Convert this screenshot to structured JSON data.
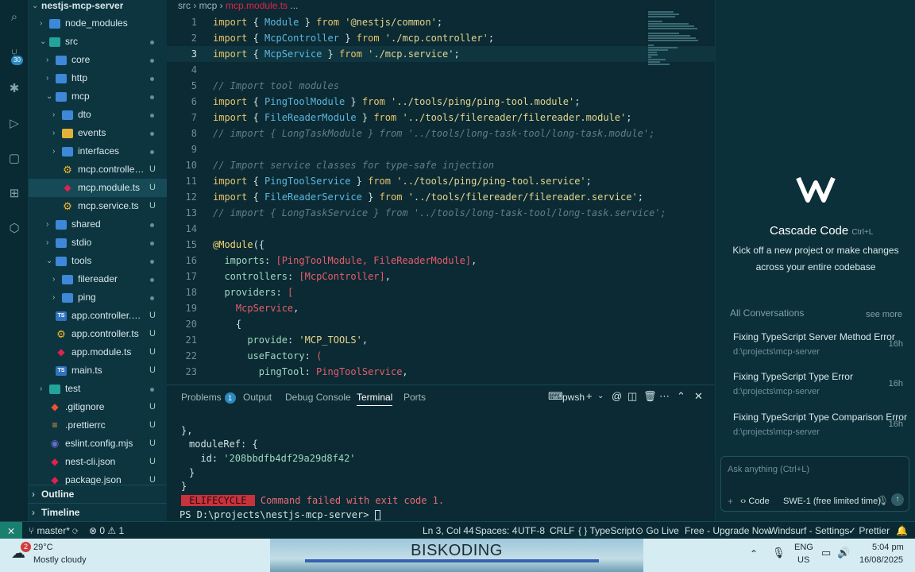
{
  "breadcrumb": [
    "src",
    "mcp",
    "mcp.module.ts",
    "..."
  ],
  "activity": {
    "scm_badge": "30"
  },
  "explorer": {
    "root": "nestjs-mcp-server",
    "rows": [
      {
        "label": "node_modules",
        "depth": 1,
        "kind": "folder",
        "chev": "›",
        "stat": ""
      },
      {
        "label": "src",
        "depth": 1,
        "kind": "folder teal",
        "chev": "⌄",
        "stat": "dot"
      },
      {
        "label": "core",
        "depth": 2,
        "kind": "folder",
        "chev": "›",
        "stat": "dot"
      },
      {
        "label": "http",
        "depth": 2,
        "kind": "folder",
        "chev": "›",
        "stat": "dot"
      },
      {
        "label": "mcp",
        "depth": 2,
        "kind": "folder",
        "chev": "⌄",
        "stat": "dot"
      },
      {
        "label": "dto",
        "depth": 3,
        "kind": "folder",
        "chev": "›",
        "stat": "dot"
      },
      {
        "label": "events",
        "depth": 3,
        "kind": "folder yellow",
        "chev": "›",
        "stat": "dot"
      },
      {
        "label": "interfaces",
        "depth": 3,
        "kind": "folder",
        "chev": "›",
        "stat": "dot"
      },
      {
        "label": "mcp.controller.ts",
        "depth": 3,
        "kind": "gear",
        "chev": "",
        "stat": "U"
      },
      {
        "label": "mcp.module.ts",
        "depth": 3,
        "kind": "nest",
        "chev": "",
        "stat": "U",
        "selected": true
      },
      {
        "label": "mcp.service.ts",
        "depth": 3,
        "kind": "gear",
        "chev": "",
        "stat": "U"
      },
      {
        "label": "shared",
        "depth": 2,
        "kind": "folder",
        "chev": "›",
        "stat": "dot"
      },
      {
        "label": "stdio",
        "depth": 2,
        "kind": "folder",
        "chev": "›",
        "stat": "dot"
      },
      {
        "label": "tools",
        "depth": 2,
        "kind": "folder",
        "chev": "⌄",
        "stat": "dot"
      },
      {
        "label": "filereader",
        "depth": 3,
        "kind": "folder",
        "chev": "›",
        "stat": "dot"
      },
      {
        "label": "ping",
        "depth": 3,
        "kind": "folder",
        "chev": "›",
        "stat": "dot"
      },
      {
        "label": "app.controller.spe...",
        "depth": 2,
        "kind": "ts",
        "chev": "",
        "stat": "U"
      },
      {
        "label": "app.controller.ts",
        "depth": 2,
        "kind": "gear",
        "chev": "",
        "stat": "U"
      },
      {
        "label": "app.module.ts",
        "depth": 2,
        "kind": "nest",
        "chev": "",
        "stat": "U"
      },
      {
        "label": "main.ts",
        "depth": 2,
        "kind": "ts",
        "chev": "",
        "stat": "U"
      },
      {
        "label": "test",
        "depth": 1,
        "kind": "folder teal",
        "chev": "›",
        "stat": "dot"
      },
      {
        "label": ".gitignore",
        "depth": 1,
        "kind": "git",
        "chev": "",
        "stat": "U"
      },
      {
        "label": ".prettierrc",
        "depth": 1,
        "kind": "prettier",
        "chev": "",
        "stat": "U"
      },
      {
        "label": "eslint.config.mjs",
        "depth": 1,
        "kind": "eslint",
        "chev": "",
        "stat": "U"
      },
      {
        "label": "nest-cli.json",
        "depth": 1,
        "kind": "nest",
        "chev": "",
        "stat": "U"
      },
      {
        "label": "package.json",
        "depth": 1,
        "kind": "nest",
        "chev": "",
        "stat": "U"
      }
    ],
    "sections": [
      "Outline",
      "Timeline"
    ]
  },
  "editor": {
    "current_line": 3,
    "lines": [
      [
        [
          "kw",
          "import"
        ],
        [
          "pr",
          " { "
        ],
        [
          "id",
          "Module"
        ],
        [
          "pr",
          " } "
        ],
        [
          "kw",
          "from"
        ],
        [
          "str",
          " '@nestjs/common'"
        ],
        [
          "pr",
          ";"
        ]
      ],
      [
        [
          "kw",
          "import"
        ],
        [
          "pr",
          " { "
        ],
        [
          "id",
          "McpController"
        ],
        [
          "pr",
          " } "
        ],
        [
          "kw",
          "from"
        ],
        [
          "str",
          " './mcp.controller'"
        ],
        [
          "pr",
          ";"
        ]
      ],
      [
        [
          "kw",
          "import"
        ],
        [
          "pr",
          " { "
        ],
        [
          "id",
          "McpService"
        ],
        [
          "pr",
          " } "
        ],
        [
          "kw",
          "from"
        ],
        [
          "str",
          " './mcp.service'"
        ],
        [
          "pr",
          ";"
        ]
      ],
      [],
      [
        [
          "cm",
          "// Import tool modules"
        ]
      ],
      [
        [
          "kw",
          "import"
        ],
        [
          "pr",
          " { "
        ],
        [
          "id",
          "PingToolModule"
        ],
        [
          "pr",
          " } "
        ],
        [
          "kw",
          "from"
        ],
        [
          "str",
          " '../tools/ping/ping-tool.module'"
        ],
        [
          "pr",
          ";"
        ]
      ],
      [
        [
          "kw",
          "import"
        ],
        [
          "pr",
          " { "
        ],
        [
          "id",
          "FileReaderModule"
        ],
        [
          "pr",
          " } "
        ],
        [
          "kw",
          "from"
        ],
        [
          "str",
          " '../tools/filereader/filereader.module'"
        ],
        [
          "pr",
          ";"
        ]
      ],
      [
        [
          "cm",
          "// import { LongTaskModule } from '../tools/long-task-tool/long-task.module';"
        ]
      ],
      [],
      [
        [
          "cm",
          "// Import service classes for type-safe injection"
        ]
      ],
      [
        [
          "kw",
          "import"
        ],
        [
          "pr",
          " { "
        ],
        [
          "id",
          "PingToolService"
        ],
        [
          "pr",
          " } "
        ],
        [
          "kw",
          "from"
        ],
        [
          "str",
          " '../tools/ping/ping-tool.service'"
        ],
        [
          "pr",
          ";"
        ]
      ],
      [
        [
          "kw",
          "import"
        ],
        [
          "pr",
          " { "
        ],
        [
          "id",
          "FileReaderService"
        ],
        [
          "pr",
          " } "
        ],
        [
          "kw",
          "from"
        ],
        [
          "str",
          " '../tools/filereader/filereader.service'"
        ],
        [
          "pr",
          ";"
        ]
      ],
      [
        [
          "cm",
          "// import { LongTaskService } from '../tools/long-task-tool/long-task.service';"
        ]
      ],
      [],
      [
        [
          "deco",
          "@Module"
        ],
        [
          "pr",
          "({"
        ]
      ],
      [
        [
          "pr",
          "  "
        ],
        [
          "prop",
          "imports"
        ],
        [
          "pr",
          ": "
        ],
        [
          "arr",
          "[PingToolModule, FileReaderModule]"
        ],
        [
          "pr",
          ","
        ]
      ],
      [
        [
          "pr",
          "  "
        ],
        [
          "prop",
          "controllers"
        ],
        [
          "pr",
          ": "
        ],
        [
          "arr",
          "[McpController]"
        ],
        [
          "pr",
          ","
        ]
      ],
      [
        [
          "pr",
          "  "
        ],
        [
          "prop",
          "providers"
        ],
        [
          "pr",
          ": "
        ],
        [
          "arr",
          "["
        ]
      ],
      [
        [
          "pr",
          "    "
        ],
        [
          "arr",
          "McpService"
        ],
        [
          "pr",
          ","
        ]
      ],
      [
        [
          "pr",
          "    {"
        ]
      ],
      [
        [
          "pr",
          "      "
        ],
        [
          "prop",
          "provide"
        ],
        [
          "pr",
          ": "
        ],
        [
          "str",
          "'MCP_TOOLS'"
        ],
        [
          "pr",
          ","
        ]
      ],
      [
        [
          "pr",
          "      "
        ],
        [
          "prop",
          "useFactory"
        ],
        [
          "pr",
          ": "
        ],
        [
          "arr",
          "("
        ]
      ],
      [
        [
          "pr",
          "        "
        ],
        [
          "prop",
          "pingTool"
        ],
        [
          "pr",
          ": "
        ],
        [
          "arr",
          "PingToolService"
        ],
        [
          "pr",
          ","
        ]
      ]
    ]
  },
  "panel": {
    "tabs": [
      "Problems",
      "Output",
      "Debug Console",
      "Terminal",
      "Ports"
    ],
    "active_tab": "Terminal",
    "problems_count": "1",
    "shell": "pwsh",
    "terminal": {
      "l1": "},",
      "l2": "moduleRef: {",
      "l3a": "  id: ",
      "l3b": "'208bbdfb4df29a29d8f42'",
      "l4": "}",
      "l5": "}",
      "err_label": " ELIFECYCLE ",
      "err_text": " Command failed with exit code 1.",
      "prompt": "PS D:\\projects\\nestjs-mcp-server> "
    }
  },
  "cascade": {
    "title": "Cascade Code",
    "shortcut": "Ctrl+L",
    "subtitle1": "Kick off a new project or make changes",
    "subtitle2": "across your entire codebase",
    "all_conversations": "All Conversations",
    "see_more": "see more",
    "conversations": [
      {
        "title": "Fixing TypeScript Server Method Error",
        "path": "d:\\projects\\mcp-server",
        "age": "16h"
      },
      {
        "title": "Fixing TypeScript Type Error",
        "path": "d:\\projects\\mcp-server",
        "age": "16h"
      },
      {
        "title": "Fixing TypeScript Type Comparison Error",
        "path": "d:\\projects\\mcp-server",
        "age": "16h"
      }
    ],
    "input_placeholder": "Ask anything (Ctrl+L)",
    "mode": "Code",
    "model": "SWE-1 (free limited time)"
  },
  "status": {
    "branch": "master*",
    "errors": "0",
    "warnings": "1",
    "position": "Ln 3, Col 44",
    "spaces": "Spaces: 4",
    "encoding": "UTF-8",
    "eol": "CRLF",
    "language": "TypeScript",
    "golive": "Go Live",
    "upgrade": "Free - Upgrade Now",
    "windsurf": "Windsurf - Settings",
    "prettier": "Prettier"
  },
  "taskbar": {
    "weather_temp": "29°C",
    "weather_desc": "Mostly cloudy",
    "weather_badge": "2",
    "banner": "BISKODING",
    "lang1": "ENG",
    "lang2": "US",
    "time": "5:04 pm",
    "date": "16/08/2025"
  },
  "colors": {
    "accent": "#2a8ac0",
    "error": "#c8323d",
    "remote": "#1a7f6e"
  }
}
